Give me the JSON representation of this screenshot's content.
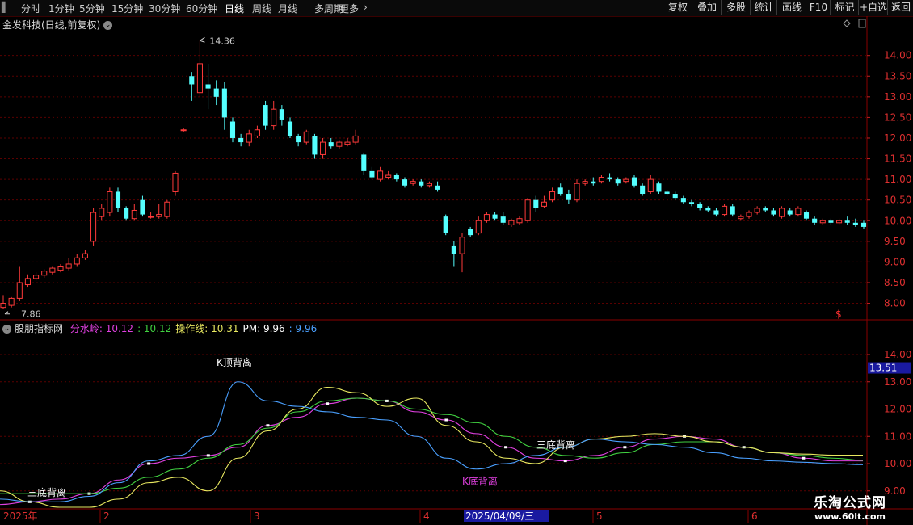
{
  "toolbar": {
    "left_tabs": [
      "分时",
      "1分钟",
      "5分钟",
      "15分钟",
      "30分钟",
      "60分钟",
      "日线",
      "周线",
      "月线",
      "多周期",
      "更多"
    ],
    "active_tab": "日线",
    "more_arrow": "›",
    "right_buttons": [
      "复权",
      "叠加",
      "多股",
      "统计",
      "画线",
      "F10",
      "标记",
      "+自选",
      "返回"
    ]
  },
  "chart": {
    "title": "金发科技(日线,前复权)",
    "high_label": "14.36",
    "low_label": "7.86",
    "dollar_marker": "$",
    "price_axis": [
      "14.00",
      "13.50",
      "13.00",
      "12.50",
      "12.00",
      "11.50",
      "11.00",
      "10.50",
      "10.00",
      "9.50",
      "9.00",
      "8.50",
      "8.00"
    ]
  },
  "indicator": {
    "name": "股朋指标网",
    "items": [
      {
        "label": "分水岭:",
        "value": "10.12",
        "color": "#e040e0"
      },
      {
        "label": ":",
        "value": "10.12",
        "color": "#40d040"
      },
      {
        "label": "操作线:",
        "value": "10.31",
        "color": "#e8e860"
      },
      {
        "label": "PM:",
        "value": "9.96",
        "color": "#ffffff"
      },
      {
        "label": ":",
        "value": "9.96",
        "color": "#4aa0ff"
      }
    ],
    "axis": [
      "14.00",
      "13.00",
      "12.00",
      "11.00",
      "10.00",
      "9.00"
    ],
    "current_value": "13.51",
    "annotations": {
      "k_top": "K顶背离",
      "tri_bottom_1": "三底背离",
      "k_bottom": "K底背离",
      "tri_bottom_2": "三底背离"
    }
  },
  "date_axis": {
    "year": "2025年",
    "months": [
      "2",
      "3",
      "4",
      "5",
      "6"
    ],
    "cursor_date": "2025/04/09/三"
  },
  "watermark": {
    "title": "乐淘公式网",
    "url": "www.60lt.com"
  },
  "colors": {
    "up": "#ff3a3a",
    "down": "#54ffff",
    "grid": "#5a0000",
    "axis_text": "#e03030",
    "magenta": "#e040e0",
    "green": "#40d040",
    "yellow": "#e8e860",
    "blue": "#4aa0ff"
  },
  "chart_data": {
    "type": "candlestick",
    "price_range": [
      7.6,
      14.6
    ],
    "candles": [
      [
        7.9,
        8.0,
        8.2,
        7.86
      ],
      [
        7.95,
        8.12,
        8.15,
        7.9
      ],
      [
        8.12,
        8.5,
        8.9,
        8.05
      ],
      [
        8.45,
        8.6,
        8.7,
        8.4
      ],
      [
        8.6,
        8.68,
        8.75,
        8.55
      ],
      [
        8.68,
        8.78,
        8.82,
        8.62
      ],
      [
        8.75,
        8.85,
        8.9,
        8.7
      ],
      [
        8.8,
        8.9,
        8.95,
        8.75
      ],
      [
        8.85,
        8.95,
        9.1,
        8.8
      ],
      [
        8.95,
        9.1,
        9.2,
        8.9
      ],
      [
        9.1,
        9.2,
        9.3,
        9.05
      ],
      [
        9.5,
        10.2,
        10.3,
        9.4
      ],
      [
        10.1,
        10.3,
        10.4,
        10.0
      ],
      [
        10.2,
        10.7,
        10.8,
        10.1
      ],
      [
        10.7,
        10.3,
        10.8,
        10.2
      ],
      [
        10.3,
        10.05,
        10.35,
        10.0
      ],
      [
        10.05,
        10.25,
        10.4,
        10.0
      ],
      [
        10.5,
        10.15,
        10.6,
        10.1
      ],
      [
        10.1,
        10.1,
        10.2,
        10.05
      ],
      [
        10.1,
        10.15,
        10.4,
        10.05
      ],
      [
        10.1,
        10.45,
        10.5,
        10.05
      ],
      [
        10.7,
        11.15,
        11.2,
        10.6
      ],
      [
        12.2,
        12.2,
        12.25,
        12.15
      ],
      [
        13.5,
        13.3,
        13.6,
        12.9
      ],
      [
        13.1,
        13.8,
        14.36,
        13.0
      ],
      [
        13.3,
        13.2,
        13.8,
        12.7
      ],
      [
        13.2,
        13.0,
        13.4,
        12.8
      ],
      [
        13.2,
        12.5,
        13.35,
        12.2
      ],
      [
        12.4,
        12.0,
        12.5,
        11.9
      ],
      [
        12.0,
        11.9,
        12.1,
        11.8
      ],
      [
        11.9,
        12.1,
        12.2,
        11.8
      ],
      [
        12.05,
        12.2,
        12.3,
        12.0
      ],
      [
        12.8,
        12.3,
        12.9,
        12.2
      ],
      [
        12.3,
        12.7,
        12.9,
        12.2
      ],
      [
        12.7,
        12.45,
        12.8,
        12.3
      ],
      [
        12.4,
        12.05,
        12.5,
        12.0
      ],
      [
        12.05,
        11.9,
        12.1,
        11.8
      ],
      [
        11.9,
        12.15,
        12.2,
        11.85
      ],
      [
        12.05,
        11.6,
        12.1,
        11.5
      ],
      [
        11.6,
        11.9,
        12.0,
        11.5
      ],
      [
        11.9,
        11.8,
        12.0,
        11.75
      ],
      [
        11.8,
        11.9,
        11.95,
        11.75
      ],
      [
        11.85,
        11.9,
        12.0,
        11.8
      ],
      [
        11.9,
        12.05,
        12.2,
        11.85
      ],
      [
        11.6,
        11.2,
        11.65,
        11.1
      ],
      [
        11.2,
        11.05,
        11.3,
        11.0
      ],
      [
        11.0,
        11.2,
        11.3,
        10.95
      ],
      [
        11.05,
        11.1,
        11.2,
        11.0
      ],
      [
        11.1,
        11.0,
        11.15,
        10.95
      ],
      [
        11.0,
        10.85,
        11.05,
        10.8
      ],
      [
        10.9,
        10.95,
        11.0,
        10.85
      ],
      [
        10.95,
        10.85,
        11.0,
        10.8
      ],
      [
        10.85,
        10.9,
        10.95,
        10.8
      ],
      [
        10.85,
        10.75,
        10.95,
        10.7
      ],
      [
        10.1,
        9.7,
        10.15,
        9.65
      ],
      [
        9.4,
        9.2,
        9.5,
        8.9
      ],
      [
        9.2,
        9.6,
        9.7,
        8.75
      ],
      [
        9.8,
        9.65,
        9.85,
        9.6
      ],
      [
        9.7,
        10.0,
        10.1,
        9.65
      ],
      [
        10.0,
        10.15,
        10.2,
        9.95
      ],
      [
        10.15,
        10.05,
        10.2,
        10.0
      ],
      [
        10.1,
        9.95,
        10.2,
        9.9
      ],
      [
        9.9,
        10.0,
        10.05,
        9.85
      ],
      [
        9.95,
        10.05,
        10.1,
        9.9
      ],
      [
        10.0,
        10.5,
        10.55,
        9.95
      ],
      [
        10.5,
        10.3,
        10.6,
        10.2
      ],
      [
        10.35,
        10.45,
        10.6,
        10.3
      ],
      [
        10.5,
        10.7,
        10.8,
        10.45
      ],
      [
        10.8,
        10.65,
        10.9,
        10.6
      ],
      [
        10.65,
        10.5,
        10.75,
        10.4
      ],
      [
        10.5,
        10.9,
        11.0,
        10.45
      ],
      [
        10.9,
        10.95,
        11.0,
        10.85
      ],
      [
        10.95,
        10.9,
        11.05,
        10.85
      ],
      [
        10.95,
        11.05,
        11.1,
        10.9
      ],
      [
        11.05,
        11.0,
        11.15,
        10.95
      ],
      [
        11.0,
        10.9,
        11.05,
        10.85
      ],
      [
        10.95,
        11.0,
        11.05,
        10.9
      ],
      [
        11.05,
        10.85,
        11.1,
        10.8
      ],
      [
        10.85,
        10.65,
        10.9,
        10.6
      ],
      [
        10.7,
        11.0,
        11.1,
        10.65
      ],
      [
        10.9,
        10.7,
        10.95,
        10.65
      ],
      [
        10.7,
        10.65,
        10.75,
        10.6
      ],
      [
        10.65,
        10.55,
        10.7,
        10.5
      ],
      [
        10.55,
        10.45,
        10.6,
        10.4
      ],
      [
        10.45,
        10.4,
        10.5,
        10.35
      ],
      [
        10.4,
        10.3,
        10.45,
        10.25
      ],
      [
        10.3,
        10.25,
        10.35,
        10.2
      ],
      [
        10.25,
        10.15,
        10.3,
        10.1
      ],
      [
        10.15,
        10.35,
        10.4,
        10.1
      ],
      [
        10.35,
        10.15,
        10.4,
        10.1
      ],
      [
        10.05,
        10.1,
        10.15,
        10.0
      ],
      [
        10.1,
        10.2,
        10.25,
        10.05
      ],
      [
        10.2,
        10.3,
        10.35,
        10.15
      ],
      [
        10.3,
        10.25,
        10.35,
        10.2
      ],
      [
        10.25,
        10.15,
        10.3,
        10.1
      ],
      [
        10.1,
        10.3,
        10.35,
        10.05
      ],
      [
        10.25,
        10.15,
        10.3,
        10.1
      ],
      [
        10.15,
        10.3,
        10.35,
        10.1
      ],
      [
        10.2,
        10.05,
        10.25,
        10.0
      ],
      [
        10.05,
        9.95,
        10.1,
        9.9
      ],
      [
        9.95,
        10.0,
        10.05,
        9.9
      ],
      [
        10.0,
        9.95,
        10.05,
        9.9
      ],
      [
        9.95,
        10.0,
        10.05,
        9.9
      ],
      [
        10.0,
        9.95,
        10.1,
        9.9
      ],
      [
        9.95,
        9.9,
        10.05,
        9.85
      ],
      [
        9.95,
        9.85,
        10.0,
        9.8
      ]
    ],
    "indicator_range": [
      8.4,
      14.8
    ],
    "series": [
      {
        "name": "分水岭",
        "color": "#e040e0",
        "values": [
          8.5,
          8.6,
          8.7,
          8.9,
          9.4,
          10.0,
          10.2,
          10.3,
          10.6,
          11.4,
          11.7,
          12.2,
          12.4,
          12.3,
          11.9,
          11.6,
          11.1,
          10.6,
          10.2,
          10.1,
          10.3,
          10.6,
          10.9,
          11.0,
          10.9,
          10.6,
          10.4,
          10.2,
          10.1,
          10.1
        ]
      },
      {
        "name": "",
        "color": "#40d040",
        "values": [
          8.9,
          8.9,
          8.9,
          8.9,
          9.1,
          9.5,
          9.8,
          10.2,
          10.7,
          11.3,
          11.9,
          12.3,
          12.4,
          12.3,
          12.0,
          11.8,
          11.5,
          11.0,
          10.6,
          10.3,
          10.2,
          10.4,
          10.7,
          10.8,
          10.8,
          10.6,
          10.4,
          10.3,
          10.2,
          10.12
        ]
      },
      {
        "name": "操作线",
        "color": "#e8e860",
        "values": [
          9.0,
          8.6,
          8.4,
          8.4,
          8.7,
          9.3,
          9.5,
          9.0,
          10.2,
          11.2,
          12.0,
          12.8,
          12.6,
          12.1,
          12.4,
          11.4,
          10.8,
          10.2,
          10.0,
          10.6,
          10.9,
          11.0,
          11.1,
          11.0,
          10.8,
          10.6,
          10.4,
          10.35,
          10.31,
          10.31
        ]
      },
      {
        "name": "PM",
        "color": "#4aa0ff",
        "values": [
          8.7,
          8.6,
          8.6,
          8.8,
          9.3,
          10.1,
          10.3,
          11.0,
          13.0,
          12.3,
          12.1,
          11.9,
          11.7,
          11.6,
          11.0,
          10.2,
          9.8,
          10.0,
          10.3,
          10.6,
          10.9,
          10.8,
          10.7,
          10.6,
          10.4,
          10.2,
          10.1,
          10.05,
          10.0,
          9.96
        ]
      }
    ]
  }
}
